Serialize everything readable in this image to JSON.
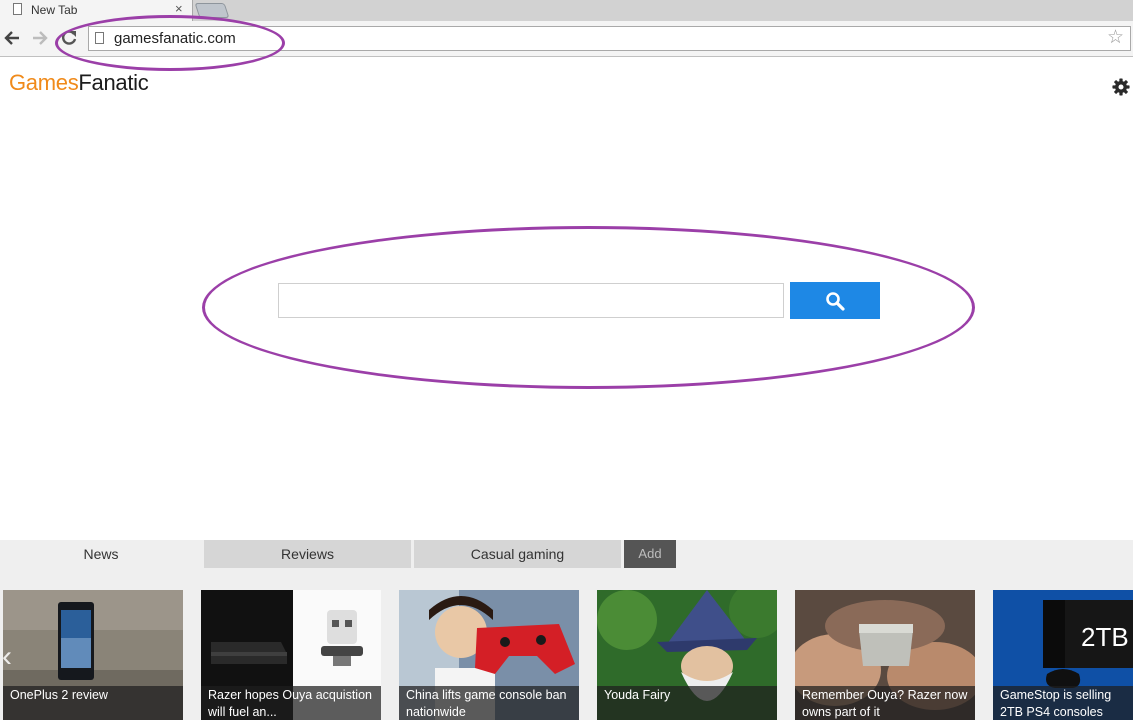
{
  "browser": {
    "tab_title": "New Tab",
    "tab_close": "×",
    "url": "gamesfanatic.com",
    "bookmark_star": "☆"
  },
  "page": {
    "logo_part1": "Games",
    "logo_part2": "Fanatic",
    "search_value": ""
  },
  "tabs": {
    "news": "News",
    "reviews": "Reviews",
    "casual": "Casual gaming",
    "add": "Add"
  },
  "carousel": {
    "prev": "‹",
    "cards": [
      {
        "caption": "OnePlus 2 review"
      },
      {
        "caption": "Razer hopes Ouya acquistion will fuel an..."
      },
      {
        "caption": "China lifts game console ban nationwide"
      },
      {
        "caption": "Youda Fairy"
      },
      {
        "caption": "Remember Ouya? Razer now owns part of it"
      },
      {
        "caption": "GameStop is selling 2TB PS4 consoles",
        "image_text": "2TB"
      }
    ]
  },
  "colors": {
    "brand_orange": "#f08a1a",
    "search_button": "#1e88e5",
    "highlight_ring": "#9b3fa8"
  }
}
